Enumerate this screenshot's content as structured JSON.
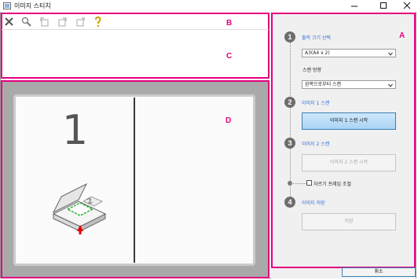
{
  "window": {
    "title": "이미지 스티치",
    "controls": [
      "minimize-icon",
      "maximize-icon",
      "close-icon"
    ]
  },
  "toolbar": {
    "tools": [
      "delete-icon",
      "zoom-icon",
      "rotate-left-icon",
      "rotate-right-icon",
      "flip-icon",
      "help-icon"
    ]
  },
  "labels": {
    "a": "A",
    "b": "B",
    "c": "C",
    "d": "D"
  },
  "panel": {
    "step1": {
      "number": "1",
      "title": "출력 크기 선택",
      "size_value": "A3(A4 x 2)",
      "scan_dir_label": "스캔 방향",
      "scan_dir_value": "왼쪽으로부터 스캔"
    },
    "step2": {
      "number": "2",
      "title": "이미지 1 스캔",
      "button": "이미지 1 스캔 시작"
    },
    "step3": {
      "number": "3",
      "title": "이미지 2 스캔",
      "button": "이미지 2 스캔 시작"
    },
    "crop": {
      "label": "자르기 프레임 조절"
    },
    "step4": {
      "number": "4",
      "title": "이미지 저장",
      "button": "저장"
    },
    "cancel": "취소"
  },
  "preview": {
    "left_number": "1"
  },
  "colors": {
    "accent_magenta": "#e4007f",
    "step_link_blue": "#2f6fd6",
    "primary_button": "#a9d3f5"
  }
}
